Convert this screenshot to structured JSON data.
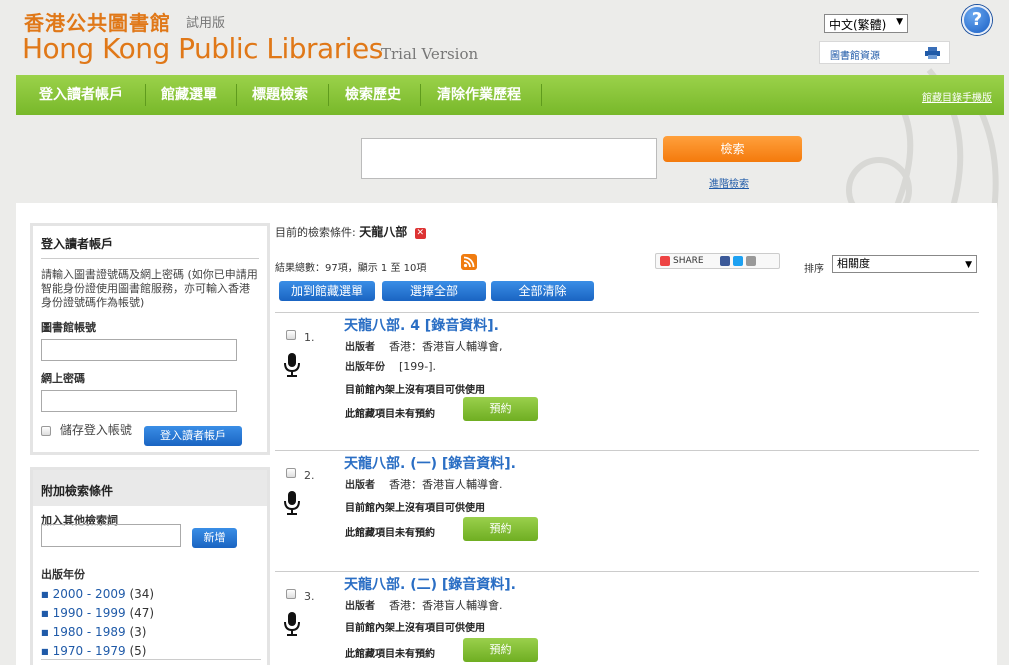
{
  "header": {
    "title_zh": "香港公共圖書館",
    "title_zh_trial": "試用版",
    "title_en": "Hong Kong Public Libraries",
    "title_en_trial": "Trial Version",
    "language": "中文(繁體)",
    "help_label": "?",
    "library_resources": "圖書館資源"
  },
  "nav": {
    "items": [
      {
        "label": "登入讀者帳戶"
      },
      {
        "label": "館藏選單"
      },
      {
        "label": "標題檢索"
      },
      {
        "label": "檢索歷史"
      },
      {
        "label": "清除作業歷程"
      }
    ],
    "mobile_link": "館藏目錄手機版"
  },
  "search": {
    "query": "",
    "button_label": "檢索",
    "advanced_link": "進階檢索"
  },
  "login": {
    "title": "登入讀者帳戶",
    "description": "請輸入圖書證號碼及網上密碼 (如你已申請用智能身份證使用圖書館服務，亦可輸入香港身份證號碼作為帳號)",
    "card_label": "圖書館帳號",
    "password_label": "網上密碼",
    "remember_label": "儲存登入帳號",
    "login_button": "登入讀者帳戶"
  },
  "filters": {
    "title": "附加檢索條件",
    "add_term_label": "加入其他檢索詞",
    "add_button": "新增",
    "year_title": "出版年份",
    "years": [
      {
        "range": "2000 - 2009",
        "count": "(34)"
      },
      {
        "range": "1990 - 1999",
        "count": "(47)"
      },
      {
        "range": "1980 - 1989",
        "count": "(3)"
      },
      {
        "range": "1970 - 1979",
        "count": "(5)"
      }
    ]
  },
  "results_meta": {
    "criteria_label": "目前的檢索條件: ",
    "criteria_value": "天龍八部",
    "summary": "結果總數：97項，顯示 1 至 10項",
    "share_label": "SHARE",
    "sort_label": "排序",
    "sort_value": "相關度",
    "add_to_list": "加到館藏選單",
    "select_all": "選擇全部",
    "clear_all": "全部清除"
  },
  "results": [
    {
      "num": "1.",
      "title": "天龍八部. 4 [錄音資料].",
      "publisher_label": "出版者",
      "publisher": "香港：香港盲人輔導會,",
      "year_label": "出版年份",
      "year": "[199-].",
      "availability": "目前館內架上沒有項目可供使用",
      "reserve_note": "此館藏項目未有預約",
      "reserve_button": "預約"
    },
    {
      "num": "2.",
      "title": "天龍八部. (一) [錄音資料].",
      "publisher_label": "出版者",
      "publisher": "香港：香港盲人輔導會.",
      "availability": "目前館內架上沒有項目可供使用",
      "reserve_note": "此館藏項目未有預約",
      "reserve_button": "預約"
    },
    {
      "num": "3.",
      "title": "天龍八部. (二) [錄音資料].",
      "publisher_label": "出版者",
      "publisher": "香港：香港盲人輔導會.",
      "availability": "目前館內架上沒有項目可供使用",
      "reserve_note": "此館藏項目未有預約",
      "reserve_button": "預約"
    }
  ]
}
